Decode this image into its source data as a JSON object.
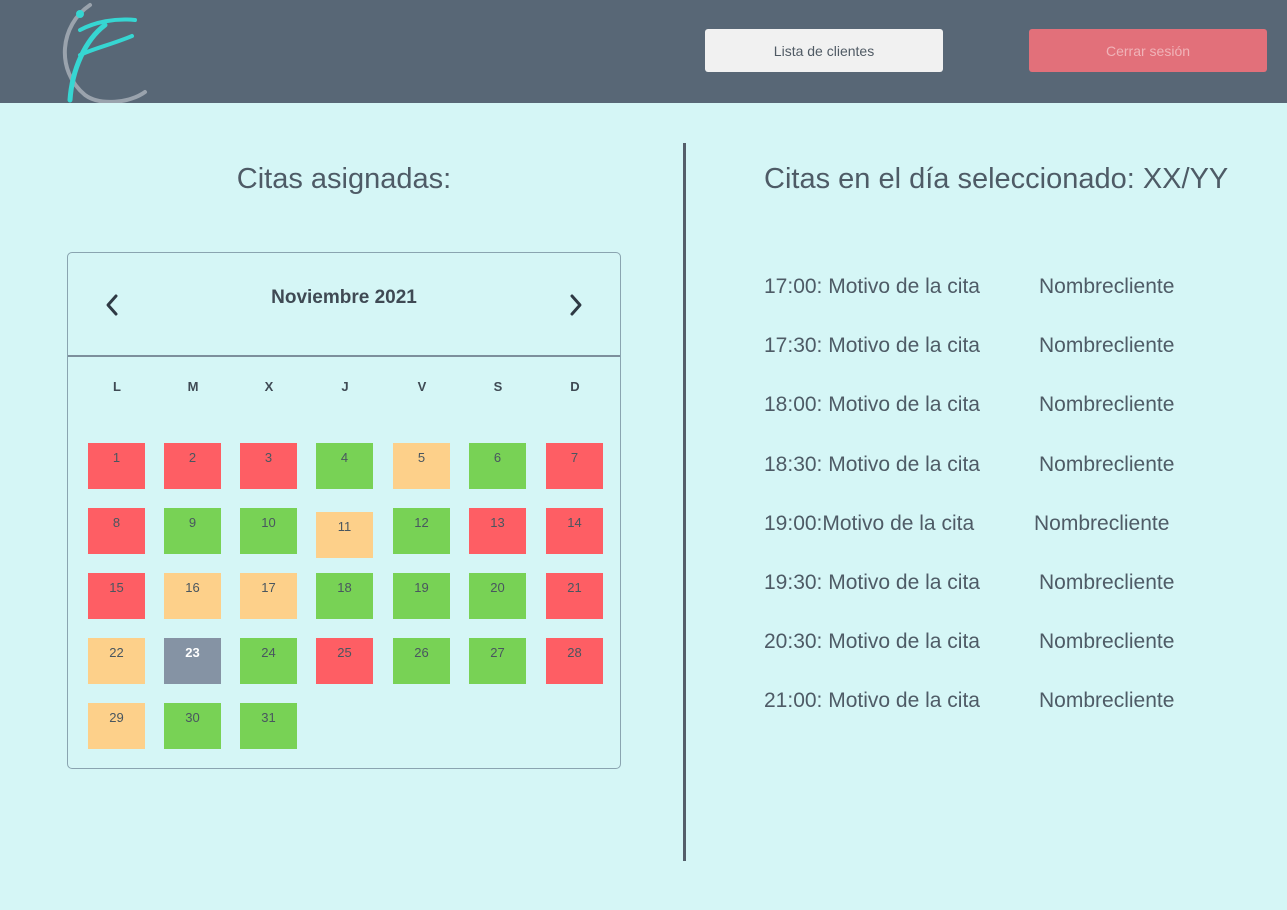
{
  "header": {
    "list_button": "Lista de clientes",
    "logout_button": "Cerrar sesión"
  },
  "left_title": "Citas asignadas:",
  "right_title": "Citas en el día seleccionado: XX/YY",
  "calendar": {
    "month_label": "Noviembre 2021",
    "weekdays": [
      "L",
      "M",
      "X",
      "J",
      "V",
      "S",
      "D"
    ],
    "status_colors": {
      "red": "#fe5e64",
      "green": "#78d255",
      "orange": "#fdd08a",
      "selected": "#8593a4"
    },
    "days": [
      {
        "n": "1",
        "status": "red"
      },
      {
        "n": "2",
        "status": "red"
      },
      {
        "n": "3",
        "status": "red"
      },
      {
        "n": "4",
        "status": "green"
      },
      {
        "n": "5",
        "status": "orange"
      },
      {
        "n": "6",
        "status": "green"
      },
      {
        "n": "7",
        "status": "red"
      },
      {
        "n": "8",
        "status": "red"
      },
      {
        "n": "9",
        "status": "green"
      },
      {
        "n": "10",
        "status": "green"
      },
      {
        "n": "11",
        "status": "orange"
      },
      {
        "n": "12",
        "status": "green"
      },
      {
        "n": "13",
        "status": "red"
      },
      {
        "n": "14",
        "status": "red"
      },
      {
        "n": "15",
        "status": "red"
      },
      {
        "n": "16",
        "status": "orange"
      },
      {
        "n": "17",
        "status": "orange"
      },
      {
        "n": "18",
        "status": "green"
      },
      {
        "n": "19",
        "status": "green"
      },
      {
        "n": "20",
        "status": "green"
      },
      {
        "n": "21",
        "status": "red"
      },
      {
        "n": "22",
        "status": "orange"
      },
      {
        "n": "23",
        "status": "selected"
      },
      {
        "n": "24",
        "status": "green"
      },
      {
        "n": "25",
        "status": "red"
      },
      {
        "n": "26",
        "status": "green"
      },
      {
        "n": "27",
        "status": "green"
      },
      {
        "n": "28",
        "status": "red"
      },
      {
        "n": "29",
        "status": "orange"
      },
      {
        "n": "30",
        "status": "green"
      },
      {
        "n": "31",
        "status": "green"
      }
    ]
  },
  "appointments": [
    {
      "time": "17:00: Motivo de la cita",
      "client": "Nombrecliente"
    },
    {
      "time": "17:30: Motivo de la cita",
      "client": "Nombrecliente"
    },
    {
      "time": "18:00: Motivo de la cita",
      "client": "Nombrecliente"
    },
    {
      "time": "18:30: Motivo de la cita",
      "client": "Nombrecliente"
    },
    {
      "time": "19:00:Motivo de la cita",
      "client": "Nombrecliente"
    },
    {
      "time": "19:30: Motivo de la cita",
      "client": "Nombrecliente"
    },
    {
      "time": "20:30: Motivo de la cita",
      "client": "Nombrecliente"
    },
    {
      "time": "21:00: Motivo de la cita",
      "client": "Nombrecliente"
    }
  ]
}
